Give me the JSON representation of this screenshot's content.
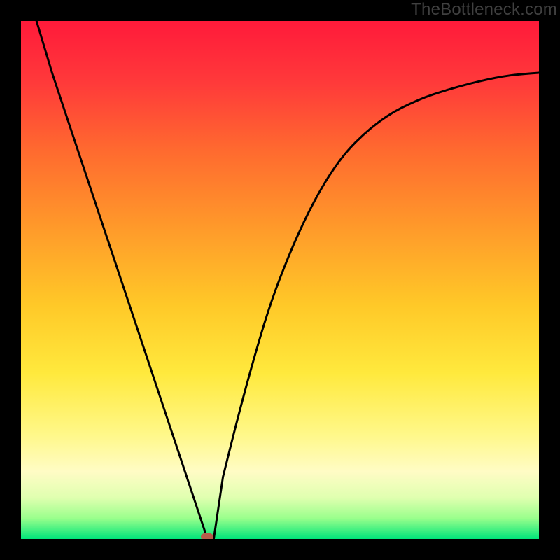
{
  "watermark": "TheBottleneck.com",
  "chart_data": {
    "type": "line",
    "title": "",
    "xlabel": "",
    "ylabel": "",
    "xlim": [
      0,
      100
    ],
    "ylim": [
      0,
      100
    ],
    "series": [
      {
        "name": "bottleneck-curve",
        "x": [
          3,
          6,
          9,
          12,
          15,
          18,
          21,
          24,
          27,
          30,
          33,
          36,
          39,
          42,
          45,
          48,
          51,
          54,
          57,
          60,
          63,
          66,
          69,
          72,
          75,
          78,
          81,
          84,
          87,
          90,
          93,
          96,
          100
        ],
        "y": [
          100,
          90,
          81,
          72,
          63,
          54,
          45,
          36,
          27,
          18,
          9,
          0,
          12,
          24,
          35,
          45,
          53,
          60,
          66,
          71,
          75,
          78,
          80.5,
          82.5,
          84,
          85.3,
          86.3,
          87.2,
          88,
          88.7,
          89.3,
          89.7,
          90
        ]
      }
    ],
    "min_marker": {
      "x": 36,
      "y": 0
    },
    "background_gradient_stops": [
      {
        "offset": 0.0,
        "color": "#ff1a3a"
      },
      {
        "offset": 0.12,
        "color": "#ff3a3a"
      },
      {
        "offset": 0.25,
        "color": "#ff6a2f"
      },
      {
        "offset": 0.4,
        "color": "#ff9a2a"
      },
      {
        "offset": 0.55,
        "color": "#ffc928"
      },
      {
        "offset": 0.68,
        "color": "#ffe93d"
      },
      {
        "offset": 0.8,
        "color": "#fff88a"
      },
      {
        "offset": 0.87,
        "color": "#fffcc5"
      },
      {
        "offset": 0.92,
        "color": "#e0ffb0"
      },
      {
        "offset": 0.96,
        "color": "#9aff8c"
      },
      {
        "offset": 1.0,
        "color": "#00e57a"
      }
    ]
  }
}
